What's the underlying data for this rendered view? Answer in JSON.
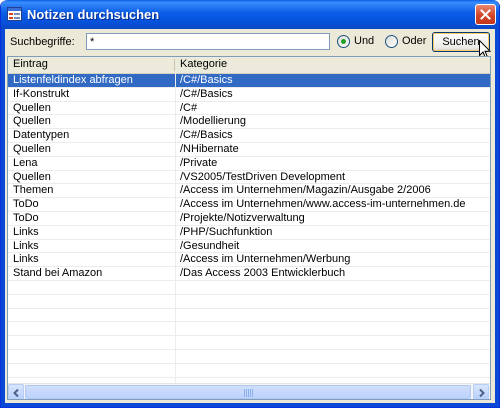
{
  "window": {
    "title": "Notizen durchsuchen"
  },
  "search": {
    "label": "Suchbegriffe:",
    "value": "*"
  },
  "options": {
    "und_label": "Und",
    "oder_label": "Oder",
    "selected": "Und"
  },
  "buttons": {
    "search_label": "Suchen"
  },
  "table": {
    "columns": [
      "Eintrag",
      "Kategorie"
    ],
    "selected_row": 0,
    "rows": [
      [
        "Listenfeldindex abfragen",
        "/C#/Basics"
      ],
      [
        "If-Konstrukt",
        "/C#/Basics"
      ],
      [
        "Quellen",
        "/C#"
      ],
      [
        "Quellen",
        "/Modellierung"
      ],
      [
        "Datentypen",
        "/C#/Basics"
      ],
      [
        "Quellen",
        "/NHibernate"
      ],
      [
        "Lena",
        "/Private"
      ],
      [
        "Quellen",
        "/VS2005/TestDriven Development"
      ],
      [
        "Themen",
        "/Access im Unternehmen/Magazin/Ausgabe 2/2006"
      ],
      [
        "ToDo",
        "/Access im Unternehmen/www.access-im-unternehmen.de"
      ],
      [
        "ToDo",
        "/Projekte/Notizverwaltung"
      ],
      [
        "Links",
        "/PHP/Suchfunktion"
      ],
      [
        "Links",
        "/Gesundheit"
      ],
      [
        "Links",
        "/Access im Unternehmen/Werbung"
      ],
      [
        "Stand bei Amazon",
        "/Das Access 2003 Entwicklerbuch"
      ]
    ]
  },
  "colors": {
    "titlebar": "#0a5ce6",
    "selection": "#316ac5",
    "dialog_bg": "#ece9d8"
  }
}
